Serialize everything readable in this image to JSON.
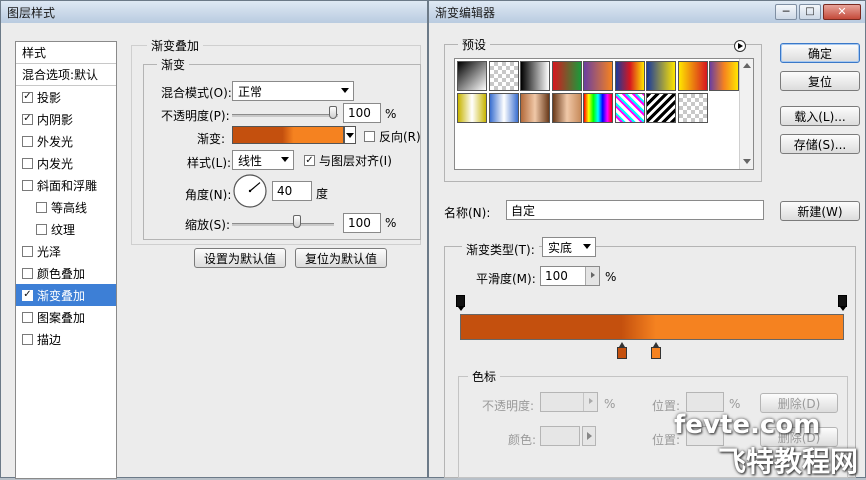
{
  "layer_style": {
    "title": "图层样式",
    "style_header": "样式",
    "items": [
      {
        "label": "混合选项:默认",
        "checkbox": false,
        "checked": false,
        "sub": false,
        "selected": false
      },
      {
        "label": "投影",
        "checkbox": true,
        "checked": true,
        "sub": false,
        "selected": false
      },
      {
        "label": "内阴影",
        "checkbox": true,
        "checked": true,
        "sub": false,
        "selected": false
      },
      {
        "label": "外发光",
        "checkbox": true,
        "checked": false,
        "sub": false,
        "selected": false
      },
      {
        "label": "内发光",
        "checkbox": true,
        "checked": false,
        "sub": false,
        "selected": false
      },
      {
        "label": "斜面和浮雕",
        "checkbox": true,
        "checked": false,
        "sub": false,
        "selected": false
      },
      {
        "label": "等高线",
        "checkbox": true,
        "checked": false,
        "sub": true,
        "selected": false
      },
      {
        "label": "纹理",
        "checkbox": true,
        "checked": false,
        "sub": true,
        "selected": false
      },
      {
        "label": "光泽",
        "checkbox": true,
        "checked": false,
        "sub": false,
        "selected": false
      },
      {
        "label": "颜色叠加",
        "checkbox": true,
        "checked": false,
        "sub": false,
        "selected": false
      },
      {
        "label": "渐变叠加",
        "checkbox": true,
        "checked": true,
        "sub": false,
        "selected": true
      },
      {
        "label": "图案叠加",
        "checkbox": true,
        "checked": false,
        "sub": false,
        "selected": false
      },
      {
        "label": "描边",
        "checkbox": true,
        "checked": false,
        "sub": false,
        "selected": false
      }
    ],
    "section_title": "渐变叠加",
    "group_title": "渐变",
    "blend_mode_label": "混合模式(O):",
    "blend_mode_value": "正常",
    "opacity_label": "不透明度(P):",
    "opacity_value": "100",
    "opacity_unit": "%",
    "gradient_label": "渐变:",
    "reverse_label": "反向(R)",
    "reverse_checked": false,
    "style_label": "样式(L):",
    "style_value": "线性",
    "align_label": "与图层对齐(I)",
    "align_checked": true,
    "angle_label": "角度(N):",
    "angle_value": "40",
    "angle_unit": "度",
    "scale_label": "缩放(S):",
    "scale_value": "100",
    "scale_unit": "%",
    "make_default": "设置为默认值",
    "reset_default": "复位为默认值"
  },
  "gradient_editor": {
    "title": "渐变编辑器",
    "presets_label": "预设",
    "ok": "确定",
    "reset": "复位",
    "load": "载入(L)...",
    "save": "存储(S)...",
    "name_label": "名称(N):",
    "name_value": "自定",
    "new": "新建(W)",
    "gradient_type_label": "渐变类型(T):",
    "gradient_type_value": "实底",
    "smoothness_label": "平滑度(M):",
    "smoothness_value": "100",
    "smoothness_unit": "%",
    "stops_group": "色标",
    "stop_opacity_label": "不透明度:",
    "stop_opacity_unit": "%",
    "location_label": "位置:",
    "location_unit": "%",
    "delete": "删除(D)",
    "color_label": "颜色:",
    "location2_label": "位置:",
    "delete2": "删除(D)"
  },
  "colors": {
    "gradient_start": "#c4500e",
    "gradient_end": "#f58220",
    "selected_blue": "#3d7fd6"
  },
  "watermark": {
    "line1": "fevte.com",
    "line2": "飞特教程网"
  }
}
